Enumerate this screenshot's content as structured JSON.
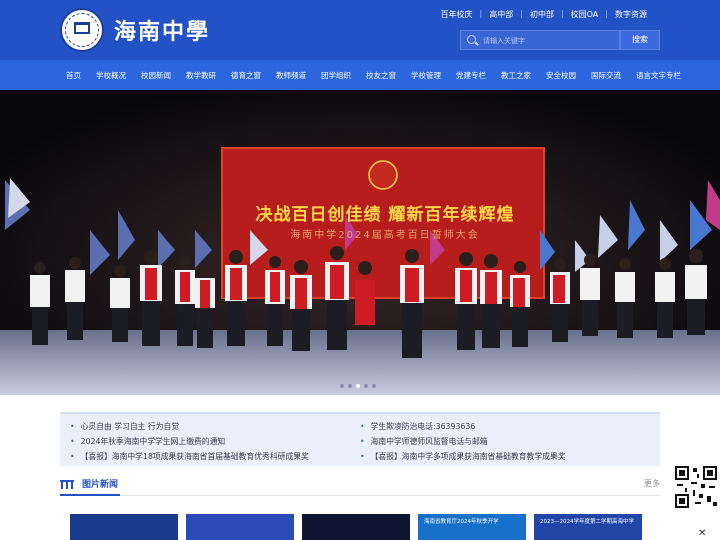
{
  "header": {
    "school_name": "海南中學",
    "top_links": [
      "百年校庆",
      "高中部",
      "初中部",
      "校园OA",
      "数字资源"
    ],
    "search": {
      "placeholder": "请输入关键字",
      "button_label": "搜索"
    }
  },
  "nav": {
    "items": [
      "首页",
      "学校概况",
      "校园新闻",
      "教学教研",
      "德育之窗",
      "教师频道",
      "团学组织",
      "校友之窗",
      "学校管理",
      "党建专栏",
      "教工之家",
      "安全校园",
      "国际交流",
      "语言文字专栏"
    ]
  },
  "banner": {
    "title": "决战百日创佳绩  耀新百年续辉煌",
    "subtitle": "海南中学2024届高考百日誓师大会",
    "slide_count": 5,
    "active_slide": 2
  },
  "news": {
    "left": [
      "心灵自由 学习自主 行为自觉",
      "2024年秋季海南中学学生网上缴费的通知",
      "【喜报】海南中学18项成果获海南省首届基础教育优秀科研成果奖"
    ],
    "right": [
      "学生欺凌防治电话:36393636",
      "海南中学师德师风监督电话与邮箱",
      "【喜报】海南中学多项成果获海南省基础教育教学成果奖"
    ]
  },
  "picture_news": {
    "title": "图片新闻",
    "more_label": "更多",
    "thumbs": [
      {
        "caption": "",
        "color": "#1a3a8c"
      },
      {
        "caption": "",
        "color": "#2a4bb5"
      },
      {
        "caption": "",
        "color": "#0e1530"
      },
      {
        "caption": "海南省教育厅2024年秋季开学",
        "color": "#1670c9"
      },
      {
        "caption": "2023—2024学年度第二学期高海中学",
        "color": "#2146a8"
      }
    ]
  },
  "colors": {
    "header": "#2352c6",
    "nav": "#2b66df",
    "accent": "#2352c6",
    "news_bg": "#eaf0fb"
  }
}
